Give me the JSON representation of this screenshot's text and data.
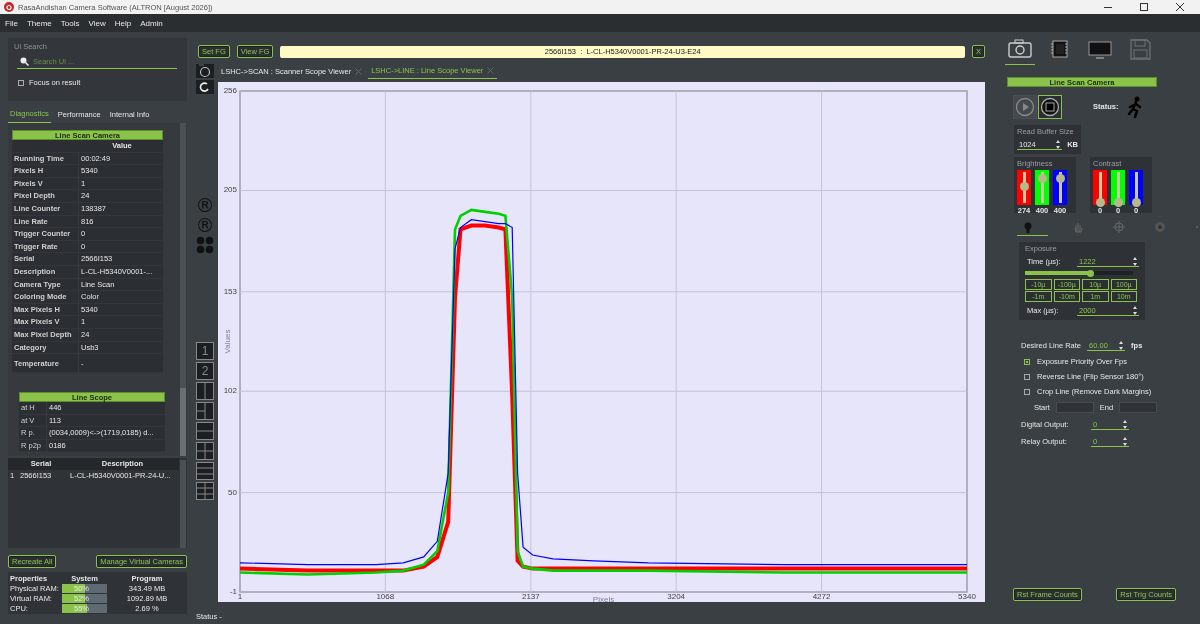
{
  "window": {
    "title": "RasaAndishan Camera Software (ALTRON [August 2026])"
  },
  "menu": [
    "File",
    "Theme",
    "Tools",
    "View",
    "Help",
    "Admin"
  ],
  "ui_search": {
    "label": "Ui Search",
    "placeholder": "Search Ui ...",
    "focus_on_result": {
      "label": "Focus on result",
      "checked": false
    }
  },
  "left_tabs": [
    {
      "label": "Diagnostics",
      "selected": true
    },
    {
      "label": "Performance",
      "selected": false
    },
    {
      "label": "Internal Info",
      "selected": false
    }
  ],
  "diagnostics": {
    "title": "Line Scan Camera",
    "value_column": "Value",
    "rows": [
      {
        "name": "Running Time",
        "value": "00:02:49"
      },
      {
        "name": "Pixels H",
        "value": "5340"
      },
      {
        "name": "Pixels V",
        "value": "1"
      },
      {
        "name": "Pixel Depth",
        "value": "24"
      },
      {
        "name": "Line Counter",
        "value": "138387"
      },
      {
        "name": "Line Rate",
        "value": "816"
      },
      {
        "name": "Trigger Counter",
        "value": "0"
      },
      {
        "name": "Trigger Rate",
        "value": "0"
      },
      {
        "name": "Serial",
        "value": "2566I153"
      },
      {
        "name": "Description",
        "value": "L-CL-H5340V0001-..."
      },
      {
        "name": "Camera Type",
        "value": "Line Scan"
      },
      {
        "name": "Coloring Mode",
        "value": "Color"
      },
      {
        "name": "Max Pixels H",
        "value": "5340"
      },
      {
        "name": "Max Pixels V",
        "value": "1"
      },
      {
        "name": "Max Pixel Depth",
        "value": "24"
      },
      {
        "name": "Category",
        "value": "Usb3"
      },
      {
        "name": "Temperature",
        "value": "-"
      }
    ]
  },
  "line_scope": {
    "title": "Line Scope",
    "rows": [
      {
        "name": "at H",
        "value": "446"
      },
      {
        "name": "at V",
        "value": "113"
      },
      {
        "name": "R p.",
        "value": "(0034,0009)<->(1719,0185) d..."
      },
      {
        "name": "R p2p",
        "value": "0186"
      }
    ]
  },
  "cameras": {
    "columns": [
      "Serial",
      "Description"
    ],
    "rows": [
      {
        "index": "1",
        "serial": "2566I153",
        "description": "L-CL-H5340V0001-PR-24-U..."
      }
    ]
  },
  "left_buttons": [
    "Recreate All",
    "Manage Virtual Cameras"
  ],
  "resources": {
    "columns": [
      "Properties",
      "System",
      "Program"
    ],
    "rows": [
      {
        "name": "Physical RAM:",
        "level": 0.5,
        "reading": "50%",
        "program": "343.49 MB"
      },
      {
        "name": "Virtual RAM:",
        "level": 0.52,
        "reading": "52%",
        "program": "1092.89 MB"
      },
      {
        "name": "CPU:",
        "level": 0.55,
        "reading": "55%",
        "program": "2.69 %"
      }
    ]
  },
  "toolbar": {
    "buttons": [
      "Set FG",
      "View FG"
    ],
    "device": "2566I153  :  L-CL-H5340V0001-PR-24-U3-E24",
    "close": "X"
  },
  "side_glyphs": [
    "®",
    "®"
  ],
  "view_buttons": [
    "1",
    "2"
  ],
  "viewer_tabs": [
    {
      "label": "LSHC->SCAN : Scanner Scope Viewer",
      "selected": false
    },
    {
      "label": "LSHC->LINE : Line Scope Viewer",
      "selected": true
    }
  ],
  "chart_data": {
    "type": "line",
    "grid": true,
    "xlabel": "Pixels",
    "ylabel": "Values",
    "xlim": [
      1,
      5340
    ],
    "ylim": [
      -1,
      256
    ],
    "xticks": [
      1,
      1068,
      2137,
      3204,
      4272,
      5340
    ],
    "yticks": [
      -1,
      50,
      102,
      153,
      205,
      256
    ],
    "x": [
      1,
      500,
      1000,
      1200,
      1350,
      1450,
      1530,
      1580,
      1620,
      1700,
      1800,
      1900,
      1950,
      2000,
      2040,
      2080,
      2150,
      2300,
      2600,
      3000,
      4000,
      5340
    ],
    "series": [
      {
        "color": "#ff0000",
        "values": [
          11,
          10,
          10,
          10,
          12,
          17,
          35,
          150,
          185,
          187,
          187,
          186,
          185,
          100,
          15,
          12,
          11,
          11,
          11,
          11,
          11,
          11
        ]
      },
      {
        "color": "#00d000",
        "values": [
          9,
          8,
          9,
          10,
          13,
          20,
          50,
          185,
          192,
          195,
          194,
          193,
          192,
          150,
          20,
          12,
          11,
          10,
          10,
          10,
          9,
          9
        ]
      },
      {
        "color": "#0000ff",
        "values": [
          14,
          13,
          13,
          14,
          17,
          25,
          60,
          175,
          186,
          190,
          189,
          188,
          188,
          186,
          60,
          22,
          18,
          16,
          15,
          14,
          13,
          13
        ]
      }
    ]
  },
  "status": "Status -",
  "device_tabs": [
    {
      "selected": true,
      "disabled": false
    },
    {
      "selected": false,
      "disabled": false
    },
    {
      "selected": false,
      "disabled": false
    },
    {
      "selected": false,
      "disabled": true
    }
  ],
  "camera_panel": {
    "title": "Line Scan Camera",
    "play": {
      "selected": false
    },
    "stop": {
      "selected": true
    },
    "status_label": "Status:",
    "read_buffer": {
      "label": "Read Buffer Size",
      "value": "1024",
      "unit": "KB"
    },
    "brightness": {
      "label": "Brightness",
      "channels": [
        {
          "color": "#ff0000",
          "level": 0.53,
          "reading": "274"
        },
        {
          "color": "#00ff00",
          "level": 0.78,
          "reading": "400"
        },
        {
          "color": "#0000ff",
          "level": 0.78,
          "reading": "400"
        }
      ]
    },
    "contrast": {
      "label": "Contrast",
      "channels": [
        {
          "color": "#ff0000",
          "level": 0,
          "reading": "0"
        },
        {
          "color": "#00ff00",
          "level": 0,
          "reading": "0"
        },
        {
          "color": "#0000ff",
          "level": 0,
          "reading": "0"
        }
      ]
    }
  },
  "tool_tabs": [
    {
      "selected": true
    },
    {
      "selected": false
    },
    {
      "selected": false
    },
    {
      "selected": false
    },
    {
      "selected": false
    }
  ],
  "exposure": {
    "label": "Exposure",
    "time_label": "Time (µs):",
    "time": "1222",
    "level": 0.6,
    "steps": [
      "-10µ",
      "-100µ",
      "10µ",
      "100µ",
      "-1m",
      "-10m",
      "1m",
      "10m"
    ],
    "max_label": "Max (µs):",
    "max": "2000"
  },
  "line_rate": {
    "label": "Desired Line Rate",
    "value": "60.00",
    "unit": "fps"
  },
  "options": [
    {
      "label": "Exposure Priority Over Fps",
      "checked": true
    },
    {
      "label": "Reverse Line (Flip Sensor 180°)",
      "checked": false
    },
    {
      "label": "Crop Line (Remove Dark Margins)",
      "checked": false
    }
  ],
  "crop": {
    "start_label": "Start",
    "end_label": "End"
  },
  "outputs": [
    {
      "label": "Digital Output:",
      "value": "0"
    },
    {
      "label": "Relay Output:",
      "value": "0"
    }
  ],
  "right_buttons": [
    "Rst Frame Counts",
    "Rst Trig Counts"
  ]
}
